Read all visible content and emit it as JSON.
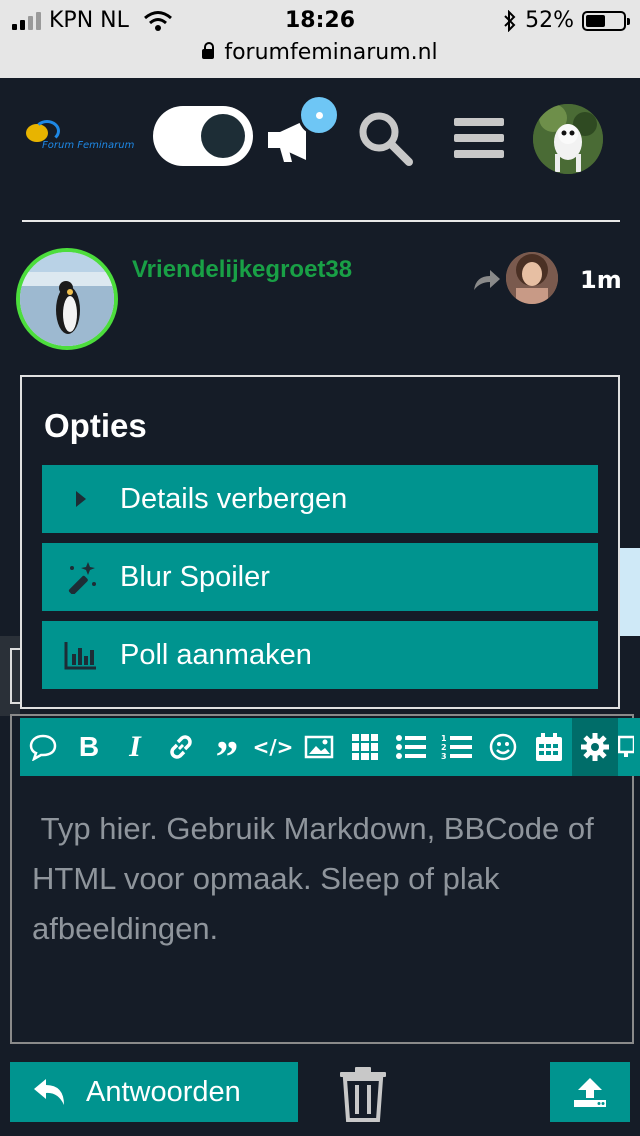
{
  "status_bar": {
    "carrier": "KPN NL",
    "time": "18:26",
    "battery_percent": "52%",
    "battery_level": 0.52,
    "url": "forumfeminarum.nl"
  },
  "header": {
    "logo_text": "Forum Feminarum",
    "theme_toggle_on": true,
    "notification_badge": "•"
  },
  "post": {
    "username": "Vriendelijkegroet38",
    "time_ago": "1m"
  },
  "options_menu": {
    "title": "Opties",
    "items": [
      {
        "label": "Details verbergen",
        "icon": "caret-right-icon"
      },
      {
        "label": "Blur Spoiler",
        "icon": "magic-wand-icon"
      },
      {
        "label": "Poll aanmaken",
        "icon": "bar-chart-icon"
      }
    ]
  },
  "editor": {
    "placeholder": " Typ hier. Gebruik Markdown, BBCode of HTML voor opmaak. Sleep of plak afbeeldingen.",
    "toolbar": [
      "quote-bubble-icon",
      "bold-icon",
      "italic-icon",
      "link-icon",
      "blockquote-icon",
      "code-icon",
      "image-icon",
      "grid-icon",
      "bullet-list-icon",
      "numbered-list-icon",
      "emoji-icon",
      "calendar-icon",
      "gear-icon",
      "preview-icon"
    ]
  },
  "footer": {
    "reply_label": "Antwoorden"
  },
  "colors": {
    "teal": "#00948f",
    "background": "#151c27",
    "username_green": "#19a046"
  }
}
